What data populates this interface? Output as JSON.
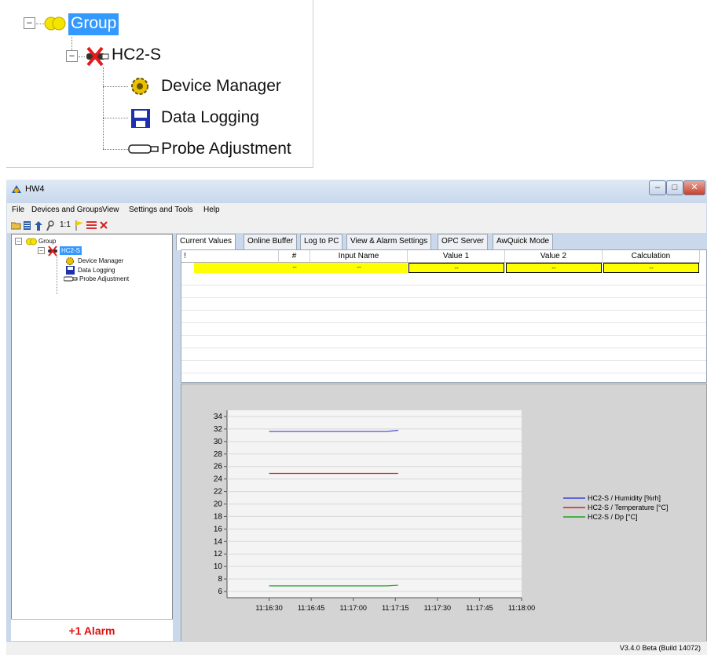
{
  "zoom_tree": {
    "group_label": "Group",
    "device_label": "HC2-S",
    "items": [
      {
        "label": "Device Manager",
        "icon": "gear-icon"
      },
      {
        "label": "Data Logging",
        "icon": "floppy-disk-icon"
      },
      {
        "label": "Probe Adjustment",
        "icon": "probe-icon"
      }
    ]
  },
  "window": {
    "title": "HW4",
    "controls": {
      "minimize": "–",
      "maximize": "□",
      "close": "✕"
    }
  },
  "menu": [
    "File",
    "Devices and Groups",
    "View",
    "Settings and Tools",
    "Help"
  ],
  "toolbar": {
    "icons": [
      "open-folder-icon",
      "list-icon",
      "upload-icon",
      "probe-tool-icon",
      "ratio-icon",
      "flag-icon",
      "alarm-list-icon",
      "delete-icon"
    ],
    "ratio_label": "1:1"
  },
  "sidebar": {
    "group_label": "Group",
    "device_label": "HC2-S",
    "items": [
      "Device Manager",
      "Data Logging",
      "Probe Adjustment"
    ],
    "alarm_text": "+1 Alarm"
  },
  "tabs": [
    "Current Values",
    "Online Buffer",
    "Log to PC",
    "View & Alarm Settings",
    "OPC Server",
    "AwQuick Mode"
  ],
  "active_tab": 0,
  "table": {
    "columns": [
      "!",
      "#",
      "Input Name",
      "Value 1",
      "Value 2",
      "Calculation"
    ],
    "row": [
      "",
      "--",
      "--",
      "--",
      "--",
      "--"
    ]
  },
  "chart_data": {
    "type": "line",
    "x": [
      "11:16:30",
      "11:16:45",
      "11:17:00",
      "11:17:15",
      "11:17:30",
      "11:17:45",
      "11:18:00"
    ],
    "ylim": [
      5,
      35
    ],
    "yticks": [
      6,
      8,
      10,
      12,
      14,
      16,
      18,
      20,
      22,
      24,
      26,
      28,
      30,
      32,
      34
    ],
    "grid": true,
    "legend_position": "right",
    "series": [
      {
        "name": "HC2-S / Humidity [%rh]",
        "color": "#4040d8",
        "points": [
          [
            "11:16:30",
            31.6
          ],
          [
            "11:17:12",
            31.6
          ],
          [
            "11:17:16",
            31.8
          ]
        ]
      },
      {
        "name": "HC2-S / Temperature [°C]",
        "color": "#d82020",
        "points": [
          [
            "11:16:30",
            24.9
          ],
          [
            "11:17:16",
            24.9
          ]
        ]
      },
      {
        "name": "HC2-S / Dp [°C]",
        "color": "#20a020",
        "points": [
          [
            "11:16:30",
            6.9
          ],
          [
            "11:17:12",
            6.9
          ],
          [
            "11:17:16",
            7.0
          ]
        ]
      }
    ]
  },
  "status": {
    "version": "V3.4.0 Beta (Build 14072)"
  },
  "colors": {
    "alarm": "#e01010",
    "selection": "#3399ff",
    "value_cells": "#ffff00"
  }
}
